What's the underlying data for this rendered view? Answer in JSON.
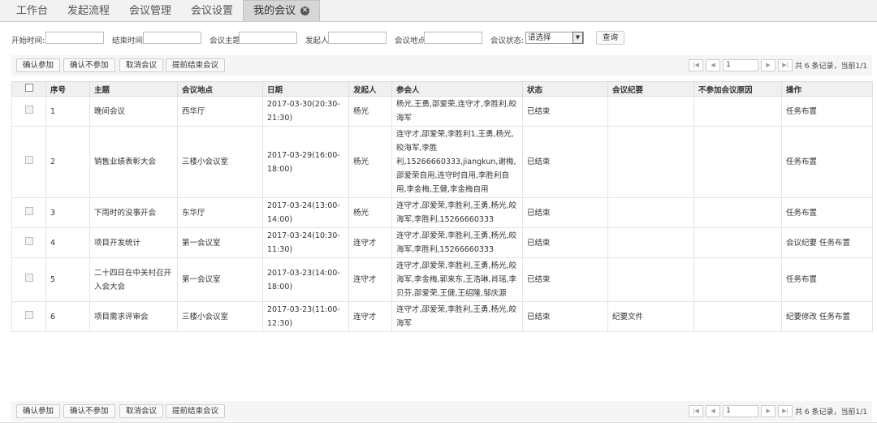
{
  "tabs": [
    "工作台",
    "发起流程",
    "会议管理",
    "会议设置",
    "我的会议"
  ],
  "filters": {
    "start_label": "开始时间:",
    "end_label": "结束时间:",
    "topic_label": "会议主题:",
    "initiator_label": "发起人:",
    "location_label": "会议地点:",
    "status_label": "会议状态:",
    "status_value": "请选择",
    "query_label": "查询"
  },
  "toolbar": {
    "confirm_attend": "确认参加",
    "confirm_not_attend": "确认不参加",
    "cancel_meeting": "取消会议",
    "end_early": "提前结束会议"
  },
  "pager": {
    "page": "1",
    "info": "共 6 条记录，当前1/1"
  },
  "table": {
    "headers": [
      "序号",
      "主题",
      "会议地点",
      "日期",
      "发起人",
      "参会人",
      "状态",
      "会议纪要",
      "不参加会议原因",
      "操作"
    ],
    "rows": [
      {
        "no": "1",
        "topic": "晚间会议",
        "location": "西华厅",
        "date": "2017-03-30(20:30-21:30)",
        "initiator": "杨光",
        "attendees": "杨光,王勇,邵爱荣,连守才,李胜利,皎海军",
        "status": "已结束",
        "minutes": "",
        "reason": "",
        "ops": [
          "任务布置"
        ]
      },
      {
        "no": "2",
        "topic": "销售业绩表彰大会",
        "location": "三楼小会议室",
        "date": "2017-03-29(16:00-18:00)",
        "initiator": "杨光",
        "attendees": "连守才,邵爱荣,李胜利1,王勇,杨光,皎海军,李胜利,15266660333,jiangkun,谢梅,邵爱荣自用,连守时自用,李胜利自用,李金梅,王健,李金梅自用",
        "status": "已结束",
        "minutes": "",
        "reason": "",
        "ops": [
          "任务布置"
        ]
      },
      {
        "no": "3",
        "topic": "下雨时的没事开会",
        "location": "东华厅",
        "date": "2017-03-24(13:00-14:00)",
        "initiator": "杨光",
        "attendees": "连守才,邵爱荣,李胜利,王勇,杨光,皎海军,李胜利,15266660333",
        "status": "已结束",
        "minutes": "",
        "reason": "",
        "ops": [
          "任务布置"
        ]
      },
      {
        "no": "4",
        "topic": "项目开发统计",
        "location": "第一会议室",
        "date": "2017-03-24(10:30-11:30)",
        "initiator": "连守才",
        "attendees": "连守才,邵爱荣,李胜利,王勇,杨光,皎海军,李胜利,15266660333",
        "status": "已结束",
        "minutes": "",
        "reason": "",
        "ops": [
          "会议纪要",
          "任务布置"
        ]
      },
      {
        "no": "5",
        "topic": "二十四日在中关村召开入会大会",
        "location": "第一会议室",
        "date": "2017-03-23(14:00-18:00)",
        "initiator": "连守才",
        "attendees": "连守才,邵爱荣,李胜利,王勇,杨光,皎海军,李金梅,郭来东,王浩琳,肖瑶,李贝芬,邵爱荣,王健,王绍隆,邹庆源",
        "status": "已结束",
        "minutes": "",
        "reason": "",
        "ops": [
          "任务布置"
        ]
      },
      {
        "no": "6",
        "topic": "项目需求评审会",
        "location": "三楼小会议室",
        "date": "2017-03-23(11:00-12:30)",
        "initiator": "连守才",
        "attendees": "连守才,邵爱荣,李胜利,王勇,杨光,皎海军",
        "status": "已结束",
        "minutes": "纪要文件",
        "reason": "",
        "ops": [
          "纪要修改",
          "任务布置"
        ]
      }
    ]
  }
}
